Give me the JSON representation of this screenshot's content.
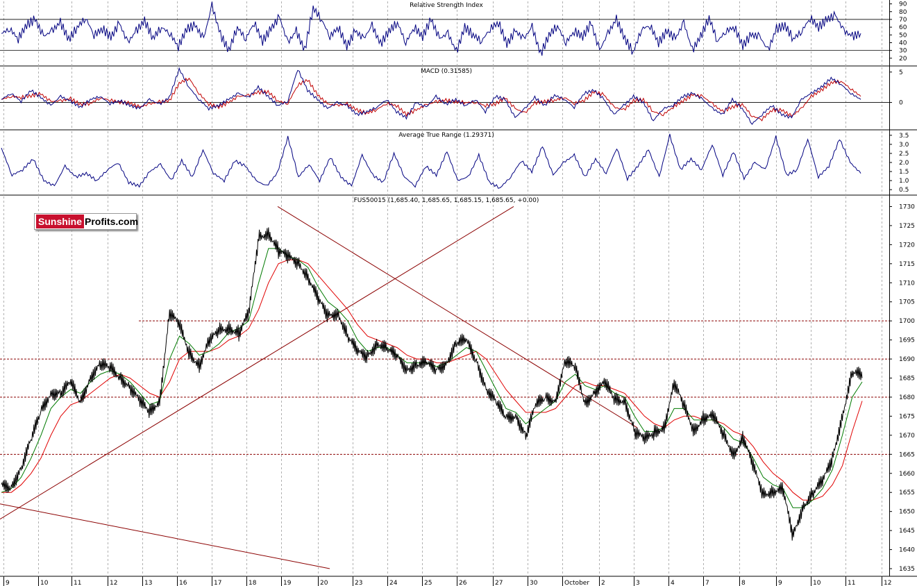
{
  "brand": {
    "part1": "Sunshine",
    "part2": "Profits.com"
  },
  "colors": {
    "rsi": "#000080",
    "macd": "#000080",
    "macd_signal": "#c00000",
    "atr": "#000080",
    "price": "#000000",
    "ma_fast": "#007a00",
    "ma_slow": "#e00000",
    "trend": "#8b0000",
    "hline": "#8b0000",
    "grid": "#b0b0b0"
  },
  "chart_data": [
    {
      "type": "line",
      "title": "Relative Strength Index",
      "y_ticks": [
        "90",
        "80",
        "70",
        "60",
        "50",
        "40",
        "30",
        "20"
      ],
      "ylim": [
        10,
        95
      ],
      "reference_lines": [
        70,
        30
      ],
      "series": [
        {
          "values": [
            52,
            58,
            45,
            63,
            70,
            48,
            55,
            66,
            44,
            60,
            72,
            50,
            58,
            47,
            65,
            40,
            55,
            68,
            46,
            60,
            52,
            35,
            58,
            62,
            45,
            88,
            50,
            30,
            60,
            45,
            66,
            42,
            58,
            73,
            40,
            55,
            30,
            85,
            70,
            48,
            60,
            35,
            55,
            45,
            62,
            38,
            55,
            66,
            40,
            60,
            48,
            70,
            45,
            52,
            28,
            60,
            50,
            42,
            58,
            66,
            38,
            55,
            45,
            60,
            25,
            50,
            62,
            40,
            55,
            48,
            65,
            30,
            52,
            70,
            45,
            28,
            58,
            62,
            40,
            55,
            45,
            66,
            30,
            48,
            72,
            42,
            55,
            60,
            36,
            50,
            48,
            30,
            58,
            62,
            45,
            55,
            72,
            60,
            70,
            75,
            55,
            48,
            52
          ]
        }
      ]
    },
    {
      "type": "line",
      "title": "MACD (0.31585)",
      "y_ticks": [
        "5",
        "0"
      ],
      "ylim": [
        -4.5,
        6
      ],
      "series": [
        {
          "values": [
            0.5,
            1.5,
            0.2,
            2.0,
            0.8,
            -0.5,
            1.0,
            0.2,
            -0.8,
            0.5,
            1.0,
            -0.2,
            0.3,
            -0.5,
            -1.0,
            0.5,
            -0.3,
            0.8,
            5.5,
            2.5,
            0.5,
            -1.0,
            -0.5,
            0.5,
            1.5,
            0.8,
            2.5,
            1.0,
            -0.5,
            0.2,
            5.5,
            2.0,
            0.5,
            -1.0,
            0.0,
            -0.5,
            -2.0,
            -1.5,
            -0.8,
            0.5,
            -1.5,
            -2.5,
            0.0,
            -0.8,
            1.0,
            -0.3,
            0.5,
            -0.5,
            0.5,
            -1.5,
            1.0,
            0.5,
            -2.5,
            -1.0,
            0.8,
            -0.5,
            1.2,
            0.5,
            -0.8,
            1.5,
            2.0,
            0.5,
            -2.0,
            -0.5,
            1.0,
            0.0,
            -3.0,
            -1.0,
            -0.5,
            1.0,
            1.5,
            0.5,
            -1.0,
            -2.0,
            0.5,
            -1.0,
            -3.5,
            -2.0,
            -0.5,
            -2.0,
            -2.5,
            0.5,
            1.5,
            2.5,
            4.0,
            3.0,
            1.5,
            0.5
          ]
        }
      ]
    },
    {
      "type": "line",
      "title": "Average True Range (1.29371)",
      "y_ticks": [
        "3.5",
        "3.0",
        "2.5",
        "2.0",
        "1.5",
        "1.0",
        "0.5"
      ],
      "ylim": [
        0.2,
        3.8
      ],
      "series": [
        {
          "values": [
            2.8,
            1.3,
            1.6,
            2.2,
            1.0,
            0.7,
            1.8,
            1.2,
            1.4,
            1.0,
            1.6,
            2.0,
            0.9,
            0.7,
            1.5,
            1.9,
            1.0,
            2.1,
            1.2,
            2.7,
            1.4,
            1.0,
            2.1,
            1.8,
            1.0,
            0.7,
            1.4,
            3.4,
            1.2,
            1.9,
            1.0,
            2.3,
            1.2,
            0.7,
            2.4,
            1.3,
            0.9,
            2.5,
            1.2,
            0.7,
            1.8,
            1.3,
            2.6,
            1.0,
            1.2,
            2.4,
            0.9,
            0.6,
            1.2,
            2.1,
            1.5,
            2.9,
            1.3,
            2.0,
            2.4,
            1.2,
            2.2,
            1.4,
            2.8,
            1.1,
            1.8,
            2.7,
            1.2,
            3.5,
            1.6,
            2.2,
            1.6,
            3.0,
            1.3,
            2.6,
            1.1,
            2.0,
            1.6,
            3.4,
            1.3,
            1.6,
            3.3,
            1.2,
            1.8,
            3.3,
            2.0,
            1.4
          ]
        }
      ]
    },
    {
      "type": "line",
      "title": "FUS50015 (1,685.40, 1,685.65, 1,685.15, 1,685.65, +0.00)",
      "y_ticks": [
        "1730",
        "1725",
        "1720",
        "1715",
        "1710",
        "1705",
        "1700",
        "1695",
        "1690",
        "1685",
        "1680",
        "1675",
        "1670",
        "1665",
        "1660",
        "1655",
        "1650",
        "1645",
        "1640",
        "1635"
      ],
      "ylim": [
        1633,
        1733
      ],
      "x_ticks": [
        "9",
        "10",
        "11",
        "12",
        "13",
        "16",
        "17",
        "18",
        "19",
        "20",
        "23",
        "24",
        "25",
        "26",
        "27",
        "30",
        "October",
        "2",
        "3",
        "4",
        "7",
        "8",
        "9",
        "10",
        "11",
        "12"
      ],
      "horizontal_levels": [
        1700,
        1690,
        1680,
        1665
      ],
      "series": [
        {
          "name": "price",
          "values": [
            1656,
            1657,
            1662,
            1668,
            1676,
            1682,
            1681,
            1683,
            1679,
            1686,
            1688,
            1687,
            1686,
            1683,
            1678,
            1676,
            1680,
            1702,
            1698,
            1692,
            1689,
            1694,
            1697,
            1699,
            1697,
            1701,
            1722,
            1724,
            1718,
            1716,
            1716,
            1712,
            1705,
            1701,
            1703,
            1696,
            1691,
            1691,
            1695,
            1692,
            1690,
            1688,
            1689,
            1688,
            1687,
            1690,
            1694,
            1694,
            1690,
            1683,
            1678,
            1674,
            1676,
            1670,
            1677,
            1680,
            1680,
            1689,
            1687,
            1679,
            1682,
            1683,
            1679,
            1680,
            1671,
            1668,
            1671,
            1673,
            1683,
            1677,
            1672,
            1675,
            1674,
            1670,
            1666,
            1669,
            1661,
            1655,
            1656,
            1655,
            1643,
            1652,
            1655,
            1657,
            1664,
            1676,
            1686,
            1685
          ]
        },
        {
          "name": "ma_fast",
          "values": [
            1655,
            1656,
            1659,
            1664,
            1670,
            1677,
            1680,
            1682,
            1681,
            1684,
            1686,
            1687,
            1686,
            1684,
            1681,
            1678,
            1679,
            1690,
            1696,
            1694,
            1691,
            1692,
            1694,
            1697,
            1698,
            1700,
            1710,
            1719,
            1719,
            1717,
            1716,
            1714,
            1709,
            1705,
            1703,
            1700,
            1695,
            1692,
            1693,
            1693,
            1691,
            1689,
            1689,
            1689,
            1688,
            1689,
            1691,
            1693,
            1692,
            1687,
            1682,
            1677,
            1676,
            1673,
            1675,
            1677,
            1679,
            1684,
            1686,
            1683,
            1682,
            1683,
            1681,
            1680,
            1675,
            1671,
            1671,
            1672,
            1677,
            1677,
            1674,
            1674,
            1674,
            1672,
            1669,
            1668,
            1664,
            1659,
            1657,
            1656,
            1651,
            1651,
            1653,
            1656,
            1661,
            1670,
            1680,
            1684
          ]
        },
        {
          "name": "ma_slow",
          "values": [
            1655,
            1655,
            1657,
            1660,
            1664,
            1670,
            1675,
            1678,
            1679,
            1681,
            1683,
            1685,
            1686,
            1685,
            1683,
            1681,
            1680,
            1684,
            1690,
            1692,
            1692,
            1692,
            1693,
            1695,
            1696,
            1698,
            1703,
            1710,
            1715,
            1716,
            1716,
            1715,
            1712,
            1709,
            1706,
            1703,
            1699,
            1696,
            1695,
            1694,
            1693,
            1691,
            1690,
            1690,
            1689,
            1689,
            1690,
            1691,
            1692,
            1690,
            1686,
            1682,
            1679,
            1676,
            1676,
            1676,
            1677,
            1680,
            1683,
            1684,
            1683,
            1683,
            1682,
            1681,
            1678,
            1675,
            1673,
            1672,
            1674,
            1675,
            1675,
            1674,
            1674,
            1673,
            1671,
            1670,
            1667,
            1663,
            1660,
            1658,
            1655,
            1653,
            1653,
            1654,
            1657,
            1662,
            1671,
            1679
          ]
        }
      ],
      "trendlines": [
        {
          "from": [
            0,
            1648
          ],
          "to": [
            740,
            1730
          ]
        },
        {
          "from": [
            400,
            1730
          ],
          "to": [
            918,
            1672
          ]
        },
        {
          "from": [
            0,
            1652
          ],
          "to": [
            475,
            1635
          ]
        }
      ]
    }
  ]
}
